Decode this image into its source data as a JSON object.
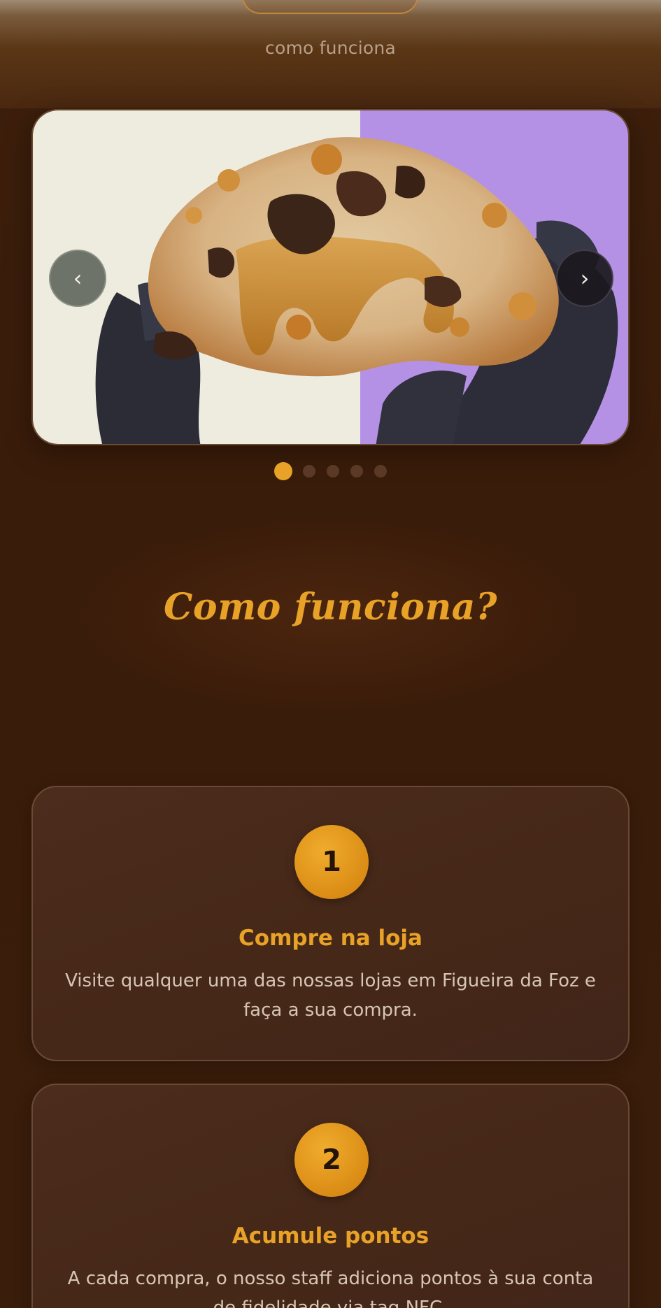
{
  "header": {
    "nav_link": "como funciona"
  },
  "carousel": {
    "prev_label": "‹",
    "next_label": "›",
    "slide_count": 5,
    "active_slide": 1
  },
  "section": {
    "title": "Como funciona?"
  },
  "steps": [
    {
      "number": "1",
      "title": "Compre na loja",
      "text": "Visite qualquer uma das nossas lojas em Figueira da Foz e faça a sua compra."
    },
    {
      "number": "2",
      "title": "Acumule pontos",
      "text": "A cada compra, o nosso staff adiciona pontos à sua conta de fidelidade via tag NFC."
    }
  ],
  "colors": {
    "accent": "#e8a227",
    "background": "#3a1d0b",
    "card": "#4a2a1b"
  }
}
